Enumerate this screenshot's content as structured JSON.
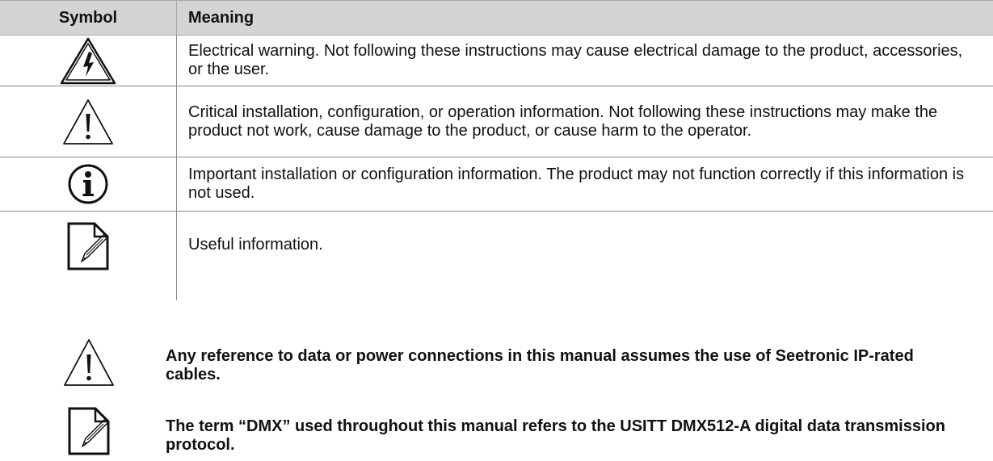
{
  "table": {
    "headers": {
      "symbol": "Symbol",
      "meaning": "Meaning"
    },
    "rows": [
      {
        "icon": "electrical-warning-icon",
        "text": "Electrical warning. Not following these instructions may cause electrical damage to the product, accessories, or the user."
      },
      {
        "icon": "caution-icon",
        "text": "Critical installation, configuration, or operation information. Not following these instructions may make the product not work, cause damage to the product, or cause harm to the operator."
      },
      {
        "icon": "info-icon",
        "text": "Important installation or configuration information. The product may not function correctly if this information is not used."
      },
      {
        "icon": "note-pencil-icon",
        "text": "Useful information."
      }
    ]
  },
  "notes": [
    {
      "icon": "caution-icon",
      "text": "Any reference to data or power connections in this manual assumes the use of Seetronic IP-rated cables."
    },
    {
      "icon": "note-pencil-icon",
      "text": "The term “DMX” used throughout this manual refers to the USITT DMX512-A digital data transmission protocol."
    }
  ]
}
